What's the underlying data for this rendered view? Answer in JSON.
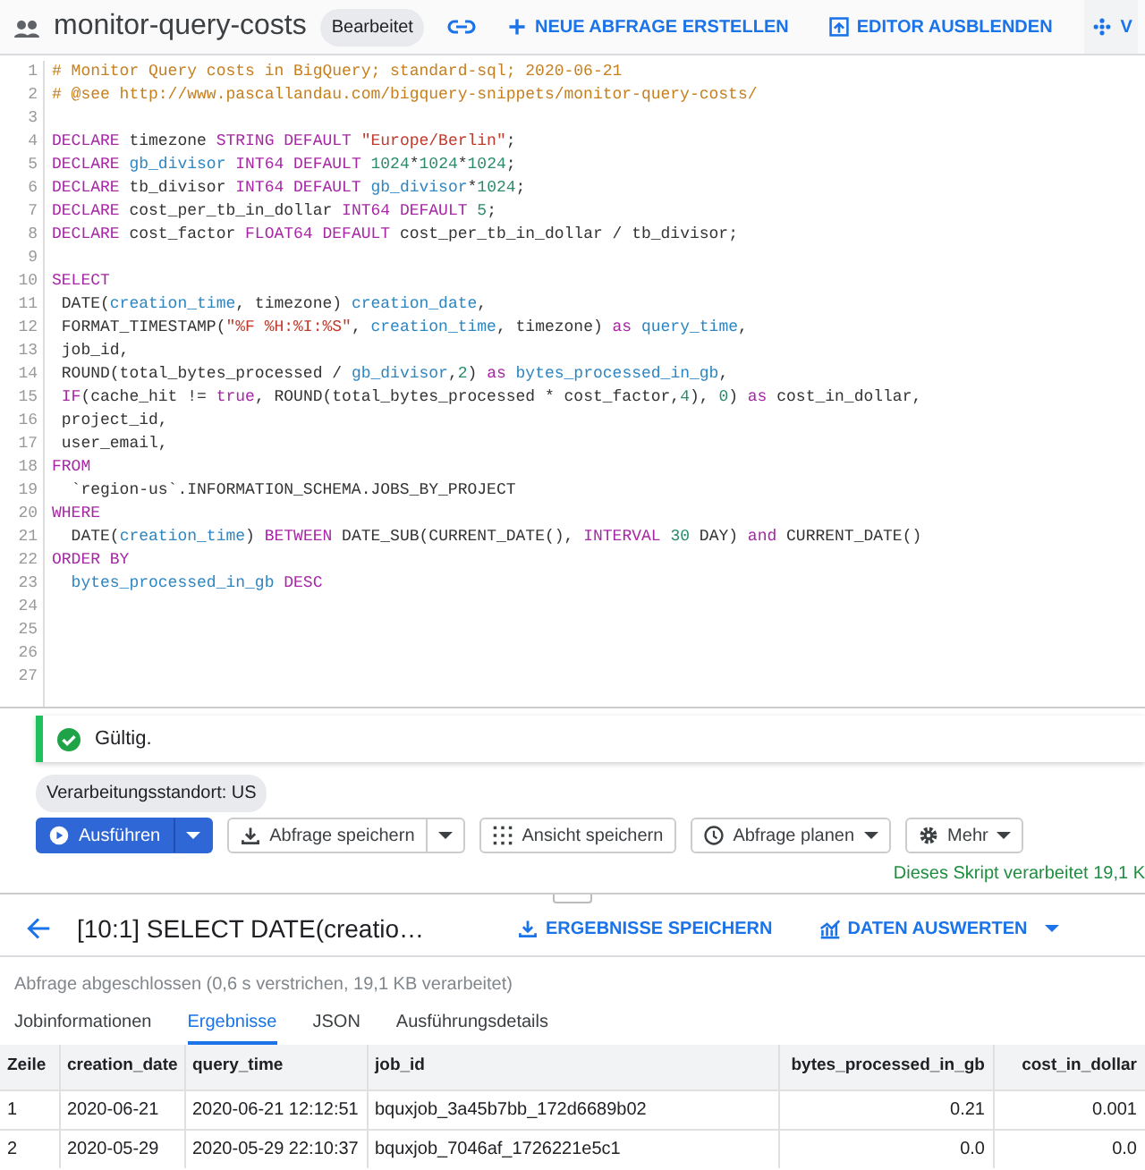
{
  "header": {
    "title": "monitor-query-costs",
    "status_chip": "Bearbeitet",
    "actions": [
      {
        "label": "NEUE ABFRAGE ERSTELLEN"
      },
      {
        "label": "EDITOR AUSBLENDEN"
      },
      {
        "label": "V"
      }
    ]
  },
  "editor": {
    "lines": [
      {
        "n": "1",
        "tokens": [
          {
            "kind": "cm",
            "text": "# Monitor Query costs in BigQuery; standard-sql; 2020-06-21"
          }
        ]
      },
      {
        "n": "2",
        "tokens": [
          {
            "kind": "cm",
            "text": "# @see http://www.pascallandau.com/bigquery-snippets/monitor-query-costs/"
          }
        ]
      },
      {
        "n": "3"
      },
      {
        "n": "4",
        "tokens": [
          {
            "kind": "kw",
            "text": "DECLARE"
          },
          {
            "kind": "p",
            "text": " timezone "
          },
          {
            "kind": "kw",
            "text": "STRING DEFAULT "
          },
          {
            "kind": "str",
            "text": "\"Europe/Berlin\""
          },
          {
            "kind": "p",
            "text": ";"
          }
        ]
      },
      {
        "n": "5",
        "tokens": [
          {
            "kind": "kw",
            "text": "DECLARE "
          },
          {
            "kind": "id",
            "text": "gb_divisor"
          },
          {
            "kind": "kw",
            "text": " INT64 DEFAULT "
          },
          {
            "kind": "num",
            "text": "1024"
          },
          {
            "kind": "p",
            "text": "*"
          },
          {
            "kind": "num",
            "text": "1024"
          },
          {
            "kind": "p",
            "text": "*"
          },
          {
            "kind": "num",
            "text": "1024"
          },
          {
            "kind": "p",
            "text": ";"
          }
        ]
      },
      {
        "n": "6",
        "tokens": [
          {
            "kind": "kw",
            "text": "DECLARE"
          },
          {
            "kind": "p",
            "text": " tb_divisor "
          },
          {
            "kind": "kw",
            "text": "INT64 DEFAULT "
          },
          {
            "kind": "id",
            "text": "gb_divisor"
          },
          {
            "kind": "p",
            "text": "*"
          },
          {
            "kind": "num",
            "text": "1024"
          },
          {
            "kind": "p",
            "text": ";"
          }
        ]
      },
      {
        "n": "7",
        "tokens": [
          {
            "kind": "kw",
            "text": "DECLARE"
          },
          {
            "kind": "p",
            "text": " cost_per_tb_in_dollar "
          },
          {
            "kind": "kw",
            "text": "INT64 DEFAULT "
          },
          {
            "kind": "num",
            "text": "5"
          },
          {
            "kind": "p",
            "text": ";"
          }
        ]
      },
      {
        "n": "8",
        "tokens": [
          {
            "kind": "kw",
            "text": "DECLARE"
          },
          {
            "kind": "p",
            "text": " cost_factor "
          },
          {
            "kind": "kw",
            "text": "FLOAT64 DEFAULT"
          },
          {
            "kind": "p",
            "text": " cost_per_tb_in_dollar / tb_divisor;"
          }
        ]
      },
      {
        "n": "9"
      },
      {
        "n": "10",
        "tokens": [
          {
            "kind": "kw",
            "text": "SELECT"
          }
        ]
      },
      {
        "n": "11",
        "tokens": [
          {
            "kind": "p",
            "text": " DATE("
          },
          {
            "kind": "id",
            "text": "creation_time"
          },
          {
            "kind": "p",
            "text": ", timezone) "
          },
          {
            "kind": "id",
            "text": "creation_date"
          },
          {
            "kind": "p",
            "text": ","
          }
        ]
      },
      {
        "n": "12",
        "tokens": [
          {
            "kind": "p",
            "text": " FORMAT_TIMESTAMP("
          },
          {
            "kind": "str",
            "text": "\"%F %H:%I:%S\""
          },
          {
            "kind": "p",
            "text": ", "
          },
          {
            "kind": "id",
            "text": "creation_time"
          },
          {
            "kind": "p",
            "text": ", timezone) "
          },
          {
            "kind": "kw",
            "text": "as "
          },
          {
            "kind": "id",
            "text": "query_time"
          },
          {
            "kind": "p",
            "text": ","
          }
        ]
      },
      {
        "n": "13",
        "tokens": [
          {
            "kind": "p",
            "text": " job_id,"
          }
        ]
      },
      {
        "n": "14",
        "tokens": [
          {
            "kind": "p",
            "text": " ROUND(total_bytes_processed / "
          },
          {
            "kind": "id",
            "text": "gb_divisor"
          },
          {
            "kind": "p",
            "text": ","
          },
          {
            "kind": "num",
            "text": "2"
          },
          {
            "kind": "p",
            "text": ") "
          },
          {
            "kind": "kw",
            "text": "as "
          },
          {
            "kind": "id",
            "text": "bytes_processed_in_gb"
          },
          {
            "kind": "p",
            "text": ","
          }
        ]
      },
      {
        "n": "15",
        "tokens": [
          {
            "kind": "kw",
            "text": " IF"
          },
          {
            "kind": "p",
            "text": "(cache_hit != "
          },
          {
            "kind": "kw",
            "text": "true"
          },
          {
            "kind": "p",
            "text": ", ROUND(total_bytes_processed * cost_factor,"
          },
          {
            "kind": "num",
            "text": "4"
          },
          {
            "kind": "p",
            "text": "), "
          },
          {
            "kind": "num",
            "text": "0"
          },
          {
            "kind": "p",
            "text": ") "
          },
          {
            "kind": "kw",
            "text": "as"
          },
          {
            "kind": "p",
            "text": " cost_in_dollar,"
          }
        ]
      },
      {
        "n": "16",
        "tokens": [
          {
            "kind": "p",
            "text": " project_id,"
          }
        ]
      },
      {
        "n": "17",
        "tokens": [
          {
            "kind": "p",
            "text": " user_email,"
          }
        ]
      },
      {
        "n": "18",
        "tokens": [
          {
            "kind": "kw",
            "text": "FROM"
          }
        ]
      },
      {
        "n": "19",
        "tokens": [
          {
            "kind": "p",
            "text": "  `region-us`.INFORMATION_SCHEMA.JOBS_BY_PROJECT"
          }
        ]
      },
      {
        "n": "20",
        "tokens": [
          {
            "kind": "kw",
            "text": "WHERE"
          }
        ]
      },
      {
        "n": "21",
        "tokens": [
          {
            "kind": "p",
            "text": "  DATE("
          },
          {
            "kind": "id",
            "text": "creation_time"
          },
          {
            "kind": "p",
            "text": ") "
          },
          {
            "kind": "kw",
            "text": "BETWEEN"
          },
          {
            "kind": "p",
            "text": " DATE_SUB(CURRENT_DATE(), "
          },
          {
            "kind": "kw",
            "text": "INTERVAL "
          },
          {
            "kind": "num",
            "text": "30"
          },
          {
            "kind": "p",
            "text": " DAY) "
          },
          {
            "kind": "kw",
            "text": "and"
          },
          {
            "kind": "p",
            "text": " CURRENT_DATE()"
          }
        ]
      },
      {
        "n": "22",
        "tokens": [
          {
            "kind": "kw",
            "text": "ORDER BY"
          }
        ]
      },
      {
        "n": "23",
        "tokens": [
          {
            "kind": "id",
            "text": "  bytes_processed_in_gb"
          },
          {
            "kind": "kw",
            "text": " DESC"
          }
        ]
      },
      {
        "n": "24"
      },
      {
        "n": "25"
      },
      {
        "n": "26"
      },
      {
        "n": "27"
      }
    ]
  },
  "validation": {
    "text": "Gültig.",
    "valid": true
  },
  "location": "Verarbeitungsstandort: US",
  "toolbar": [
    {
      "label": "Ausführen",
      "kind": "primary",
      "dropdown": true
    },
    {
      "label": "Abfrage speichern",
      "kind": "split",
      "dropdown": true
    },
    {
      "label": "Ansicht speichern",
      "kind": "plain",
      "dropdown": false
    },
    {
      "label": "Abfrage planen",
      "kind": "menu",
      "dropdown": true
    },
    {
      "label": "Mehr",
      "kind": "menu",
      "dropdown": true
    }
  ],
  "script_info": "Dieses Skript verarbeitet 19,1 K",
  "results": {
    "title": "[10:1] SELECT DATE(creatio…",
    "actions": [
      {
        "label": "ERGEBNISSE SPEICHERN",
        "dropdown": false
      },
      {
        "label": "DATEN AUSWERTEN",
        "dropdown": true
      }
    ],
    "status": "Abfrage abgeschlossen (0,6 s verstrichen, 19,1 KB verarbeitet)",
    "tabs": [
      {
        "label": "Jobinformationen",
        "selected": false
      },
      {
        "label": "Ergebnisse",
        "selected": true
      },
      {
        "label": "JSON",
        "selected": false
      },
      {
        "label": "Ausführungsdetails",
        "selected": false
      }
    ],
    "table": {
      "columns": [
        {
          "label": "Zeile",
          "kind": "text"
        },
        {
          "label": "creation_date",
          "kind": "text"
        },
        {
          "label": "query_time",
          "kind": "text"
        },
        {
          "label": "job_id",
          "kind": "text"
        },
        {
          "label": "bytes_processed_in_gb",
          "kind": "number"
        },
        {
          "label": "cost_in_dollar",
          "kind": "number"
        }
      ],
      "rows": [
        [
          "1",
          "2020-06-21",
          "2020-06-21 12:12:51",
          "bquxjob_3a45b7bb_172d6689b02",
          "0.21",
          "0.001"
        ],
        [
          "2",
          "2020-05-29",
          "2020-05-29 22:10:37",
          "bquxjob_7046af_1726221e5c1",
          "0.0",
          "0.0"
        ]
      ]
    }
  }
}
